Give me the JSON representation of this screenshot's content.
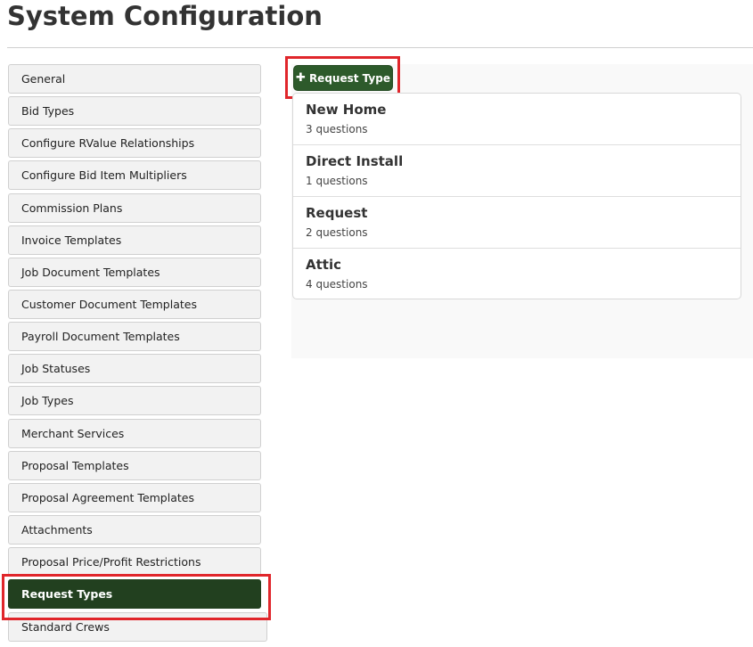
{
  "page": {
    "title": "System Configuration"
  },
  "sidebar": {
    "items": [
      {
        "label": "General"
      },
      {
        "label": "Bid Types"
      },
      {
        "label": "Configure RValue Relationships"
      },
      {
        "label": "Configure Bid Item Multipliers"
      },
      {
        "label": "Commission Plans"
      },
      {
        "label": "Invoice Templates"
      },
      {
        "label": "Job Document Templates"
      },
      {
        "label": "Customer Document Templates"
      },
      {
        "label": "Payroll Document Templates"
      },
      {
        "label": "Job Statuses"
      },
      {
        "label": "Job Types"
      },
      {
        "label": "Merchant Services"
      },
      {
        "label": "Proposal Templates"
      },
      {
        "label": "Proposal Agreement Templates"
      },
      {
        "label": "Attachments"
      },
      {
        "label": "Proposal Price/Profit Restrictions"
      },
      {
        "label": "Request Types"
      },
      {
        "label": "Standard Crews"
      }
    ],
    "active_label": "Request Types"
  },
  "main": {
    "add_button_label": "Request Type",
    "add_button_icon": "plus-icon",
    "request_types": [
      {
        "name": "New Home",
        "count": "3 questions"
      },
      {
        "name": "Direct Install",
        "count": "1 questions"
      },
      {
        "name": "Request",
        "count": "2 questions"
      },
      {
        "name": "Attic",
        "count": "4 questions"
      }
    ]
  },
  "colors": {
    "active_nav": "#22401f",
    "button_green": "#2d5a2b",
    "highlight_red": "#e0262b"
  }
}
